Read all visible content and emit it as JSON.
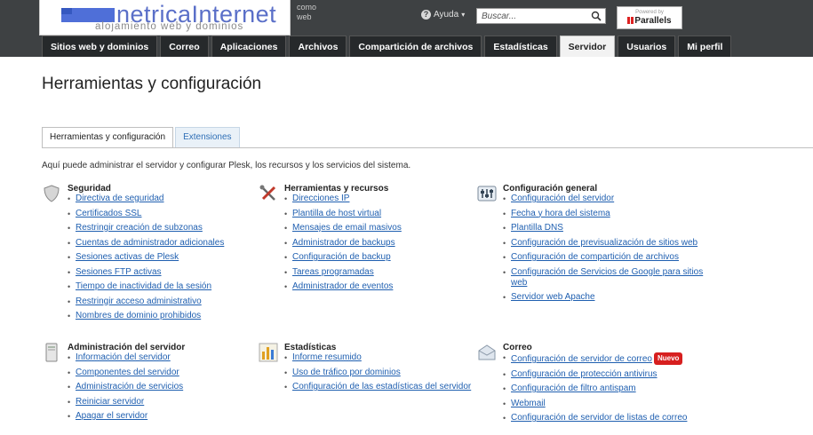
{
  "header": {
    "logo_text": "netricaInternet",
    "logo_tagline": "alojamiento web y dominios",
    "motto_lines": [
      "como",
      "web"
    ],
    "help_label": "Ayuda",
    "search_placeholder": "Buscar...",
    "powered_by": "Powered by",
    "brand": "Parallels"
  },
  "nav": {
    "tabs": [
      {
        "label": "Sitios web y dominios"
      },
      {
        "label": "Correo"
      },
      {
        "label": "Aplicaciones"
      },
      {
        "label": "Archivos"
      },
      {
        "label": "Compartición de archivos"
      },
      {
        "label": "Estadísticas"
      },
      {
        "label": "Servidor",
        "active": true
      },
      {
        "label": "Usuarios"
      },
      {
        "label": "Mi perfil"
      }
    ]
  },
  "page": {
    "title": "Herramientas y configuración",
    "subtabs": [
      {
        "label": "Herramientas y configuración",
        "active": true
      },
      {
        "label": "Extensiones"
      }
    ],
    "intro": "Aquí puede administrar el servidor y configurar Plesk, los recursos y los servicios del sistema."
  },
  "sections": [
    {
      "title": "Seguridad",
      "icon": "shield-icon",
      "links": [
        "Directiva de seguridad",
        "Certificados SSL",
        "Restringir creación de subzonas",
        "Cuentas de administrador adicionales",
        "Sesiones activas de Plesk",
        "Sesiones FTP activas",
        "Tiempo de inactividad de la sesión",
        "Restringir acceso administrativo",
        "Nombres de dominio prohibidos"
      ]
    },
    {
      "title": "Herramientas y recursos",
      "icon": "tools-icon",
      "links": [
        "Direcciones IP",
        "Plantilla de host virtual",
        "Mensajes de email masivos",
        "Administrador de backups",
        "Configuración de backup",
        "Tareas programadas",
        "Administrador de eventos"
      ]
    },
    {
      "title": "Configuración general",
      "icon": "settings-icon",
      "links": [
        "Configuración del servidor",
        "Fecha y hora del sistema",
        "Plantilla DNS",
        "Configuración de previsualización de sitios web",
        "Configuración de compartición de archivos",
        "Configuración de Servicios de Google para sitios web",
        "Servidor web Apache"
      ]
    },
    {
      "title": "Administración del servidor",
      "icon": "server-icon",
      "links": [
        "Información del servidor",
        "Componentes del servidor",
        "Administración de servicios",
        "Reiniciar servidor",
        "Apagar el servidor"
      ]
    },
    {
      "title": "Estadísticas",
      "icon": "bar-chart-icon",
      "links": [
        "Informe resumido",
        "Uso de tráfico por dominios",
        "Configuración de las estadísticas del servidor"
      ]
    },
    {
      "title": "Correo",
      "icon": "envelope-icon",
      "links": [
        "Configuración de servidor de correo",
        "Configuración de protección antivirus",
        "Configuración de filtro antispam",
        "Webmail",
        "Configuración de servidor de listas de correo"
      ],
      "badge": "Nuevo"
    }
  ]
}
